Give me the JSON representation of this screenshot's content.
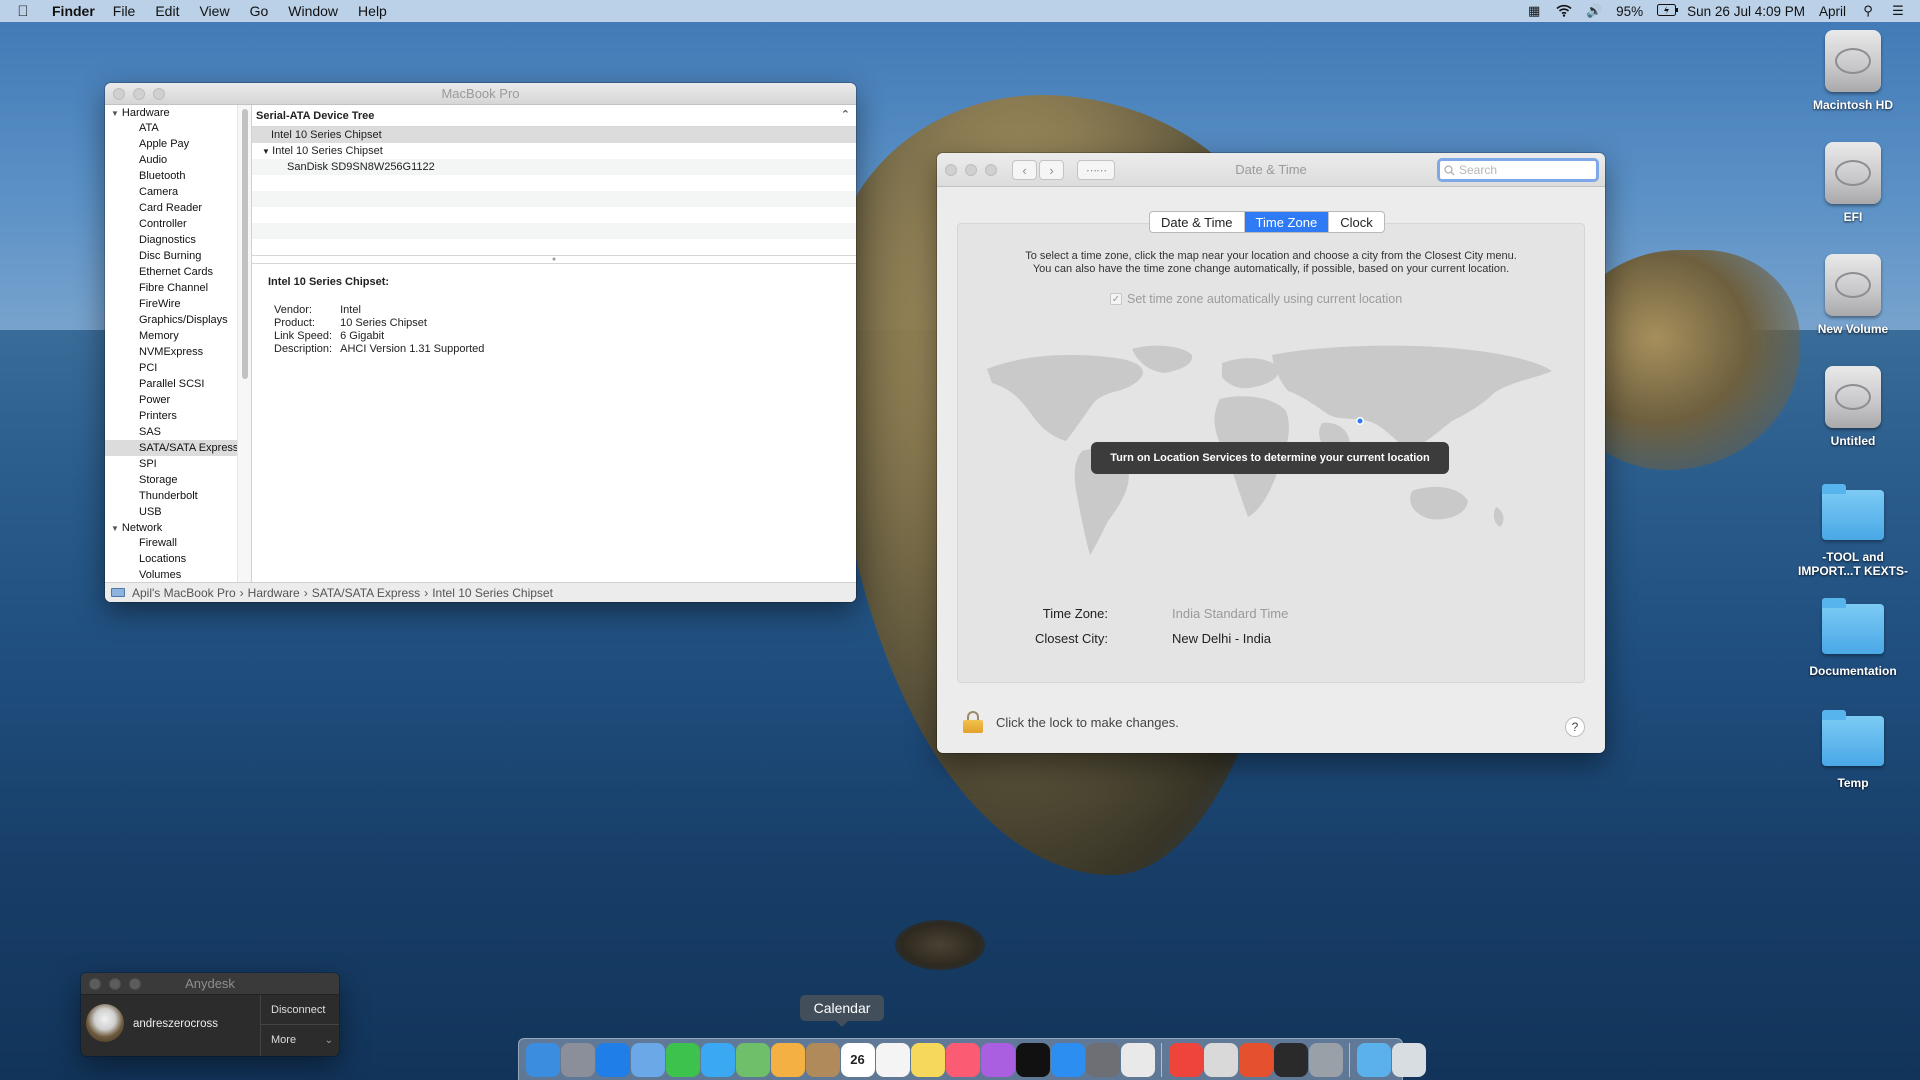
{
  "menubar": {
    "app_name": "Finder",
    "menus": [
      "File",
      "Edit",
      "View",
      "Go",
      "Window",
      "Help"
    ],
    "battery": "95%",
    "datetime": "Sun 26 Jul  4:09 PM",
    "user": "April"
  },
  "desktop_icons": [
    {
      "label": "Macintosh HD",
      "kind": "disk"
    },
    {
      "label": "EFI",
      "kind": "disk"
    },
    {
      "label": "New Volume",
      "kind": "disk"
    },
    {
      "label": "Untitled",
      "kind": "disk"
    },
    {
      "label": "-TOOL and IMPORT...T KEXTS-",
      "kind": "folder"
    },
    {
      "label": "Documentation",
      "kind": "folder"
    },
    {
      "label": "Temp",
      "kind": "folder"
    }
  ],
  "sysinfo": {
    "title": "MacBook Pro",
    "sidebar": {
      "hardware_label": "Hardware",
      "hardware_items": [
        "ATA",
        "Apple Pay",
        "Audio",
        "Bluetooth",
        "Camera",
        "Card Reader",
        "Controller",
        "Diagnostics",
        "Disc Burning",
        "Ethernet Cards",
        "Fibre Channel",
        "FireWire",
        "Graphics/Displays",
        "Memory",
        "NVMExpress",
        "PCI",
        "Parallel SCSI",
        "Power",
        "Printers",
        "SAS",
        "SATA/SATA Express",
        "SPI",
        "Storage",
        "Thunderbolt",
        "USB"
      ],
      "selected": "SATA/SATA Express",
      "network_label": "Network",
      "network_items": [
        "Firewall",
        "Locations",
        "Volumes"
      ]
    },
    "tree_header": "Serial-ATA Device Tree",
    "tree_rows": [
      {
        "label": "Intel 10 Series Chipset",
        "indent": 1
      },
      {
        "label": "Intel 10 Series Chipset",
        "indent": 0
      },
      {
        "label": "SanDisk SD9SN8W256G1122",
        "indent": 2
      }
    ],
    "details": {
      "heading": "Intel 10 Series Chipset:",
      "rows": [
        {
          "key": "Vendor:",
          "value": "Intel"
        },
        {
          "key": "Product:",
          "value": "10 Series Chipset"
        },
        {
          "key": "Link Speed:",
          "value": "6 Gigabit"
        },
        {
          "key": "Description:",
          "value": "AHCI Version 1.31 Supported"
        }
      ]
    },
    "pathbar": [
      "Apil's MacBook Pro",
      "Hardware",
      "SATA/SATA Express",
      "Intel 10 Series Chipset"
    ]
  },
  "datetime": {
    "title": "Date & Time",
    "search_placeholder": "Search",
    "tabs": [
      "Date & Time",
      "Time Zone",
      "Clock"
    ],
    "active_tab": "Time Zone",
    "instructions_line1": "To select a time zone, click the map near your location and choose a city from the Closest City menu.",
    "instructions_line2": "You can also have the time zone change automatically, if possible, based on your current location.",
    "auto_label": "Set time zone automatically using current location",
    "tooltip": "Turn on Location Services to determine your current location",
    "tz_label": "Time Zone:",
    "tz_value": "India Standard Time",
    "city_label": "Closest City:",
    "city_value": "New Delhi - India",
    "lock_text": "Click the lock to make changes.",
    "help": "?"
  },
  "anydesk": {
    "title": "Anydesk",
    "user": "andreszerocross",
    "disconnect": "Disconnect",
    "more": "More"
  },
  "dock": {
    "tooltip": "Calendar",
    "calendar_day": "26",
    "apps": [
      "finder",
      "launchpad",
      "safari",
      "mail",
      "facetime",
      "messages",
      "maps",
      "photos",
      "contacts",
      "calendar",
      "reminders",
      "notes",
      "music",
      "podcasts",
      "tv",
      "app-store",
      "system-preferences",
      "chrome",
      "anydesk",
      "preview",
      "git",
      "terminal",
      "automator",
      "folder",
      "trash"
    ]
  },
  "colors": {
    "accent": "#2f7bf5",
    "tooltip_bg": "#3c3c3c"
  }
}
